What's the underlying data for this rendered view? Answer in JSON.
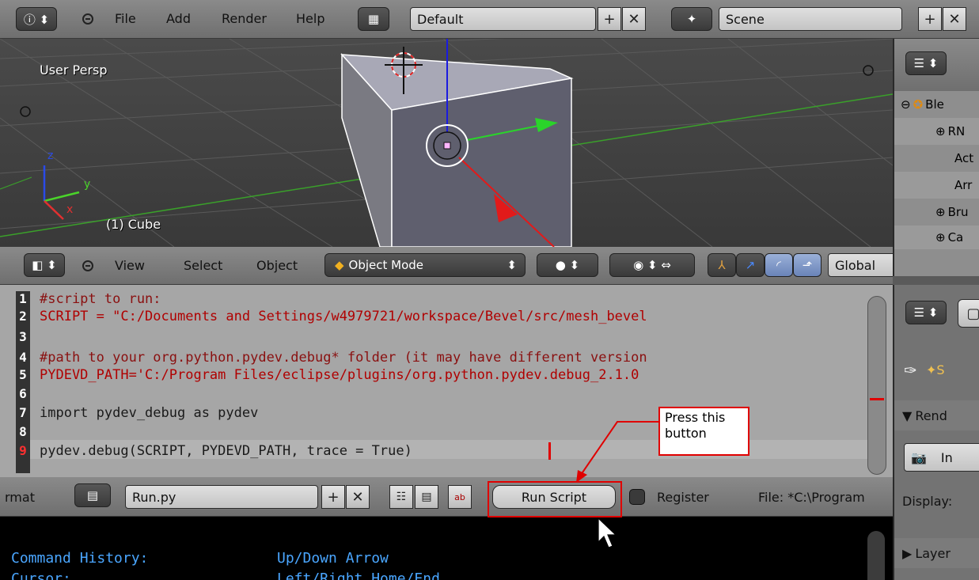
{
  "top_header": {
    "menu": [
      "File",
      "Add",
      "Render",
      "Help"
    ],
    "layout_field": "Default",
    "scene_field": "Scene"
  },
  "viewport": {
    "view_label": "User Persp",
    "object_label": "(1) Cube",
    "axes": {
      "x": "x",
      "y": "y",
      "z": "z"
    }
  },
  "viewport_header": {
    "menu": [
      "View",
      "Select",
      "Object"
    ],
    "mode": "Object Mode",
    "orientation": "Global"
  },
  "outliner": {
    "rows": [
      "Ble",
      "RN",
      "Act",
      "Arr",
      "Bru",
      "Ca"
    ]
  },
  "editor": {
    "line_numbers": [
      "1",
      "2",
      "3",
      "4",
      "5",
      "6",
      "7",
      "8",
      "9"
    ],
    "lines": [
      {
        "text": "#script to run:"
      },
      {
        "text": "SCRIPT = \"C:/Documents and Settings/w4979721/workspace/Bevel/src/mesh_bevel"
      },
      {
        "text": ""
      },
      {
        "text": "#path to your org.python.pydev.debug* folder (it may have different version"
      },
      {
        "text": "PYDEVD_PATH='C:/Program Files/eclipse/plugins/org.python.pydev.debug_2.1.0"
      },
      {
        "text": ""
      },
      {
        "text": "import pydev_debug as pydev"
      },
      {
        "text": ""
      },
      {
        "text": "pydev.debug(SCRIPT, PYDEVD_PATH, trace = True)"
      }
    ]
  },
  "editor_header": {
    "left_text": "rmat",
    "file_name": "Run.py",
    "run_button": "Run Script",
    "register_label": "Register",
    "file_path": "File: *C:\\Program"
  },
  "console": {
    "line1_key": "Command History:",
    "line1_val": "Up/Down Arrow",
    "line2_key": "Cursor:",
    "line2_val": "Left/Right Home/End"
  },
  "properties": {
    "section_render": "Rend",
    "render_button": "In",
    "display_label": "Display:",
    "section_layers": "Layer"
  },
  "annotation": {
    "text": "Press this button"
  },
  "colors": {
    "accent_red": "#e00000",
    "console_text": "#4aa6ff",
    "code_string": "#b00000",
    "code_keyword": "#a0008a",
    "code_true": "#1a1aff"
  }
}
